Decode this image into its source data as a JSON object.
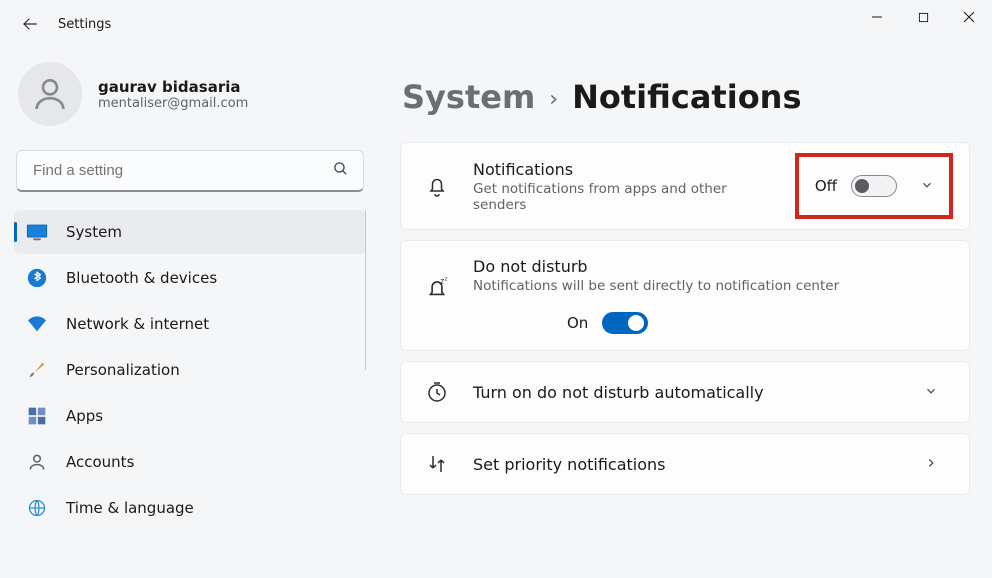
{
  "window": {
    "title": "Settings"
  },
  "profile": {
    "name": "gaurav bidasaria",
    "email": "mentaliser@gmail.com"
  },
  "search": {
    "placeholder": "Find a setting"
  },
  "sidebar": {
    "items": [
      {
        "label": "System"
      },
      {
        "label": "Bluetooth & devices"
      },
      {
        "label": "Network & internet"
      },
      {
        "label": "Personalization"
      },
      {
        "label": "Apps"
      },
      {
        "label": "Accounts"
      },
      {
        "label": "Time & language"
      }
    ]
  },
  "breadcrumb": {
    "parent": "System",
    "current": "Notifications"
  },
  "notifications_card": {
    "title": "Notifications",
    "subtitle": "Get notifications from apps and other senders",
    "state": "Off"
  },
  "dnd_card": {
    "title": "Do not disturb",
    "subtitle": "Notifications will be sent directly to notification center",
    "state": "On"
  },
  "auto_dnd": {
    "title": "Turn on do not disturb automatically"
  },
  "priority": {
    "title": "Set priority notifications"
  }
}
